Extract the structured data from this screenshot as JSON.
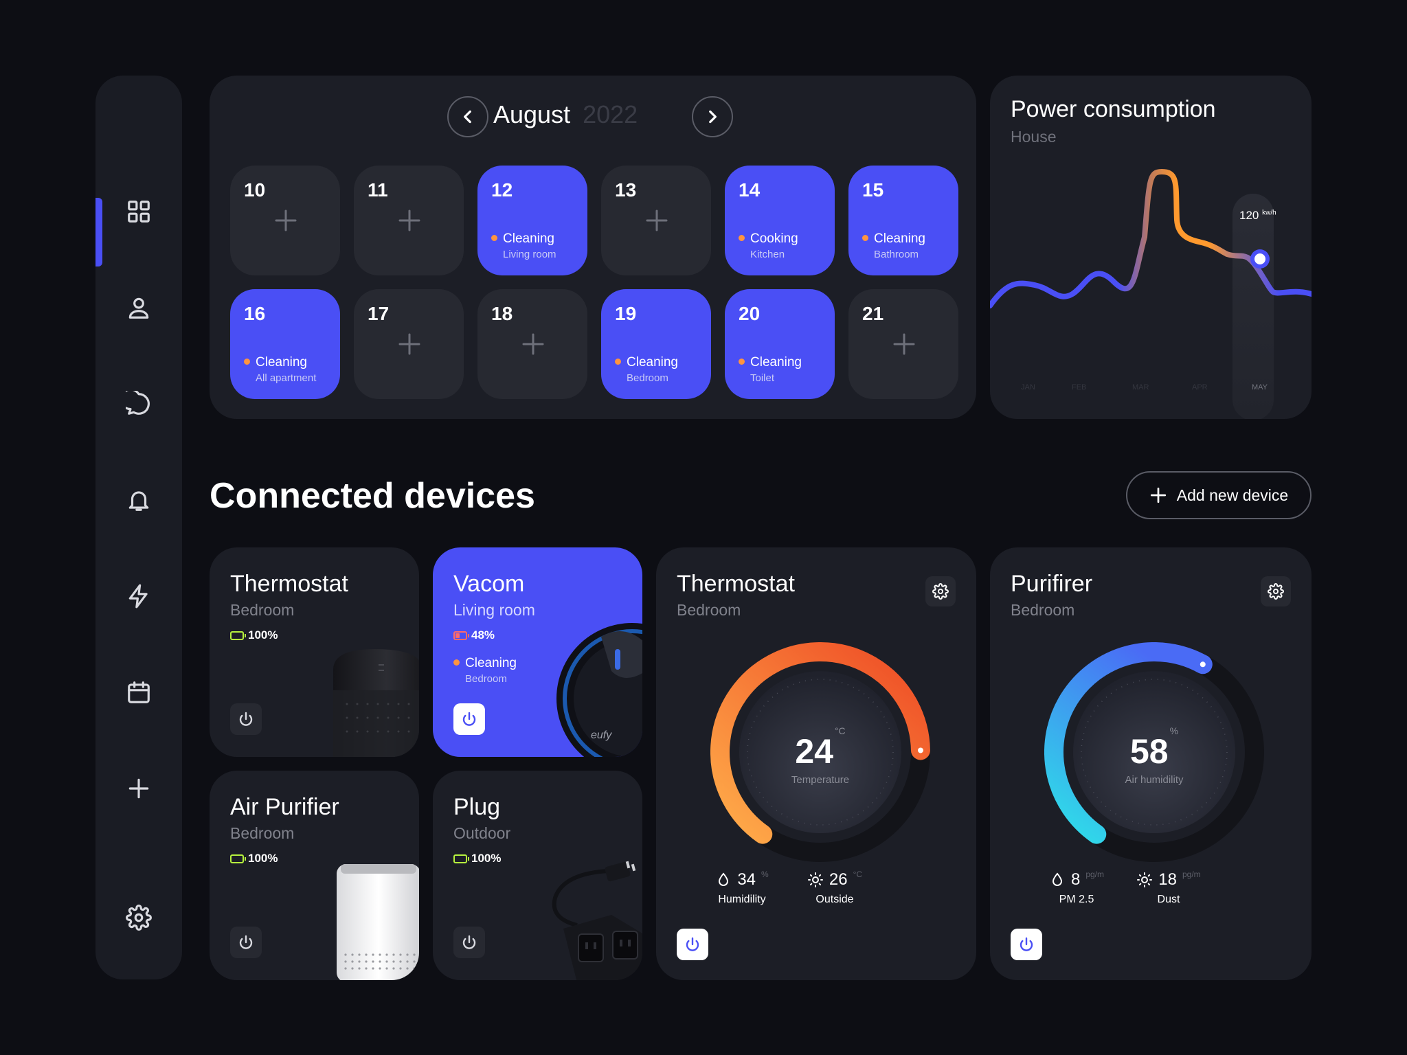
{
  "colors": {
    "accent": "#4a4ff5",
    "panel": "#1c1e26",
    "background": "#0d0e14",
    "event_dot": "#ff9440",
    "battery_ok": "#b6f23e"
  },
  "sidebar": {
    "items": [
      {
        "icon": "grid-icon",
        "active": true
      },
      {
        "icon": "user-icon"
      },
      {
        "icon": "chat-icon"
      },
      {
        "icon": "bell-icon"
      },
      {
        "icon": "lightning-icon"
      },
      {
        "icon": "calendar-icon"
      },
      {
        "icon": "plus-icon"
      },
      {
        "icon": "gear-icon"
      }
    ]
  },
  "calendar": {
    "month": "August",
    "year": "2022",
    "days": [
      {
        "num": "10"
      },
      {
        "num": "11"
      },
      {
        "num": "12",
        "event": "Cleaning",
        "place": "Living room"
      },
      {
        "num": "13"
      },
      {
        "num": "14",
        "event": "Cooking",
        "place": "Kitchen"
      },
      {
        "num": "15",
        "event": "Cleaning",
        "place": "Bathroom"
      },
      {
        "num": "16",
        "event": "Cleaning",
        "place": "All apartment"
      },
      {
        "num": "17"
      },
      {
        "num": "18"
      },
      {
        "num": "19",
        "event": "Cleaning",
        "place": "Bedroom"
      },
      {
        "num": "20",
        "event": "Cleaning",
        "place": "Toilet"
      },
      {
        "num": "21"
      }
    ]
  },
  "power": {
    "title": "Power consumption",
    "subtitle": "House",
    "value": "120",
    "unit": "kw/h",
    "months": [
      "JAN",
      "FEB",
      "MAR",
      "APR",
      "MAY"
    ],
    "selected_month": "MAY"
  },
  "devices_section": {
    "title": "Connected devices",
    "add_label": "Add new device"
  },
  "devices": {
    "thermostat_small": {
      "name": "Thermostat",
      "room": "Bedroom",
      "battery": "100%"
    },
    "vacom": {
      "name": "Vacom",
      "room": "Living room",
      "battery": "48%",
      "status": "Cleaning",
      "status_place": "Bedroom"
    },
    "air_purifier": {
      "name": "Air Purifier",
      "room": "Bedroom",
      "battery": "100%"
    },
    "plug": {
      "name": "Plug",
      "room": "Outdoor",
      "battery": "100%"
    },
    "thermostat_big": {
      "name": "Thermostat",
      "room": "Bedroom",
      "value": "24",
      "unit": "°C",
      "label": "Temperature",
      "level": 0.78,
      "stats": [
        {
          "value": "34",
          "unit": "%",
          "label": "Humidility",
          "icon": "droplet-icon"
        },
        {
          "value": "26",
          "unit": "°C",
          "label": "Outside",
          "icon": "sun-icon"
        }
      ]
    },
    "purifier_big": {
      "name": "Purifirer",
      "room": "Bedroom",
      "value": "58",
      "unit": "%",
      "label": "Air humidility",
      "level": 0.58,
      "stats": [
        {
          "value": "8",
          "unit": "pg/m",
          "label": "PM 2.5",
          "icon": "droplet-icon"
        },
        {
          "value": "18",
          "unit": "pg/m",
          "label": "Dust",
          "icon": "sun-icon"
        }
      ]
    }
  }
}
